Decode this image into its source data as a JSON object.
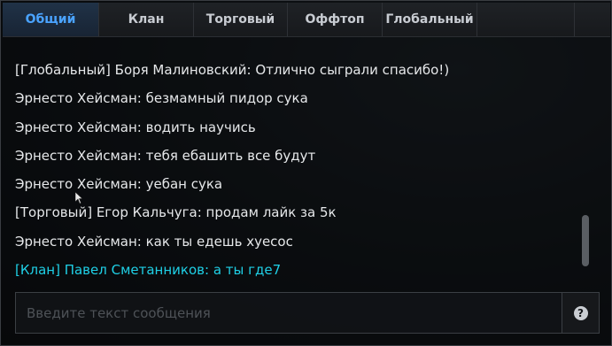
{
  "tabs": [
    {
      "label": "Общий",
      "active": true
    },
    {
      "label": "Клан",
      "active": false
    },
    {
      "label": "Торговый",
      "active": false
    },
    {
      "label": "Оффтоп",
      "active": false
    },
    {
      "label": "Глобальный",
      "active": false
    }
  ],
  "messages": [
    {
      "text": "[Глобальный] Боря Малиновский: Отлично сыграли спасибо!)",
      "channel": "global"
    },
    {
      "text": "Эрнесто Хейсман: безмамный пидор сука",
      "channel": "general"
    },
    {
      "text": "Эрнесто Хейсман: водить научись",
      "channel": "general"
    },
    {
      "text": "Эрнесто Хейсман: тебя ебашить все будут",
      "channel": "general"
    },
    {
      "text": "Эрнесто Хейсман: уебан сука",
      "channel": "general"
    },
    {
      "text": "[Торговый] Егор Кальчуга: продам лайк за 5к",
      "channel": "trade"
    },
    {
      "text": "Эрнесто Хейсман: как ты едешь хуесос",
      "channel": "general"
    },
    {
      "text": "[Клан] Павел Сметанников: а ты где7",
      "channel": "clan"
    }
  ],
  "input": {
    "placeholder": "Введите текст сообщения",
    "value": ""
  },
  "help_button": {
    "icon": "question-icon",
    "glyph": "?"
  },
  "colors": {
    "active_tab": "#4aa3ff",
    "clan_message": "#1fd0e6",
    "message_text": "#e6e8ea"
  }
}
